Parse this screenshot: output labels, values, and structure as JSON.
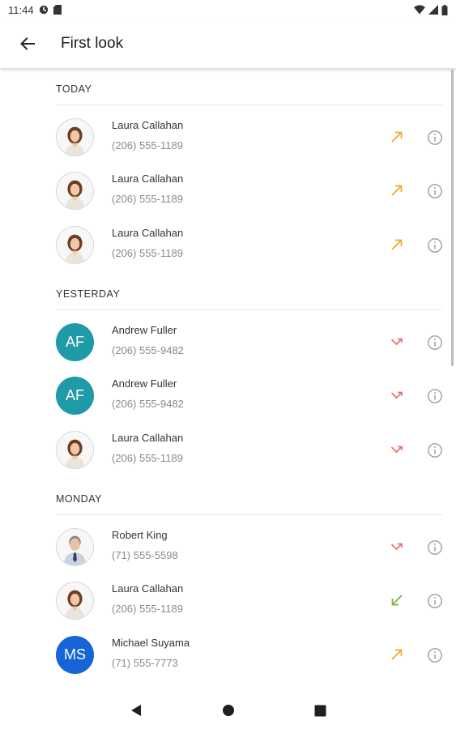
{
  "status_bar": {
    "time": "11:44",
    "icons": [
      "data-saver-icon",
      "sd-card-icon",
      "wifi-icon",
      "signal-icon",
      "battery-icon"
    ]
  },
  "app_bar": {
    "back_icon": "arrow-back-icon",
    "title": "First look"
  },
  "colors": {
    "outgoing": "#f5a623",
    "missed": "#e57373",
    "incoming": "#7cb342",
    "af_avatar": "#1e9aa8",
    "ms_avatar": "#1565d8"
  },
  "sections": [
    {
      "title": "TODAY",
      "calls": [
        {
          "name": "Laura Callahan",
          "phone": "(206) 555-1189",
          "avatar": "photo-woman",
          "type": "outgoing"
        },
        {
          "name": "Laura Callahan",
          "phone": "(206) 555-1189",
          "avatar": "photo-woman",
          "type": "outgoing"
        },
        {
          "name": "Laura Callahan",
          "phone": "(206) 555-1189",
          "avatar": "photo-woman",
          "type": "outgoing"
        }
      ]
    },
    {
      "title": "YESTERDAY",
      "calls": [
        {
          "name": "Andrew Fuller",
          "phone": "(206) 555-9482",
          "avatar": "initials",
          "initials": "AF",
          "type": "missed"
        },
        {
          "name": "Andrew Fuller",
          "phone": "(206) 555-9482",
          "avatar": "initials",
          "initials": "AF",
          "type": "missed"
        },
        {
          "name": "Laura Callahan",
          "phone": "(206) 555-1189",
          "avatar": "photo-woman",
          "type": "missed"
        }
      ]
    },
    {
      "title": "MONDAY",
      "calls": [
        {
          "name": "Robert King",
          "phone": "(71) 555-5598",
          "avatar": "photo-man",
          "type": "missed"
        },
        {
          "name": "Laura Callahan",
          "phone": "(206) 555-1189",
          "avatar": "photo-woman",
          "type": "incoming"
        },
        {
          "name": "Michael Suyama",
          "phone": "(71) 555-7773",
          "avatar": "initials",
          "initials": "MS",
          "type": "outgoing"
        }
      ]
    }
  ],
  "nav_bar": {
    "icons": [
      "back-triangle-icon",
      "home-circle-icon",
      "recents-square-icon"
    ]
  }
}
